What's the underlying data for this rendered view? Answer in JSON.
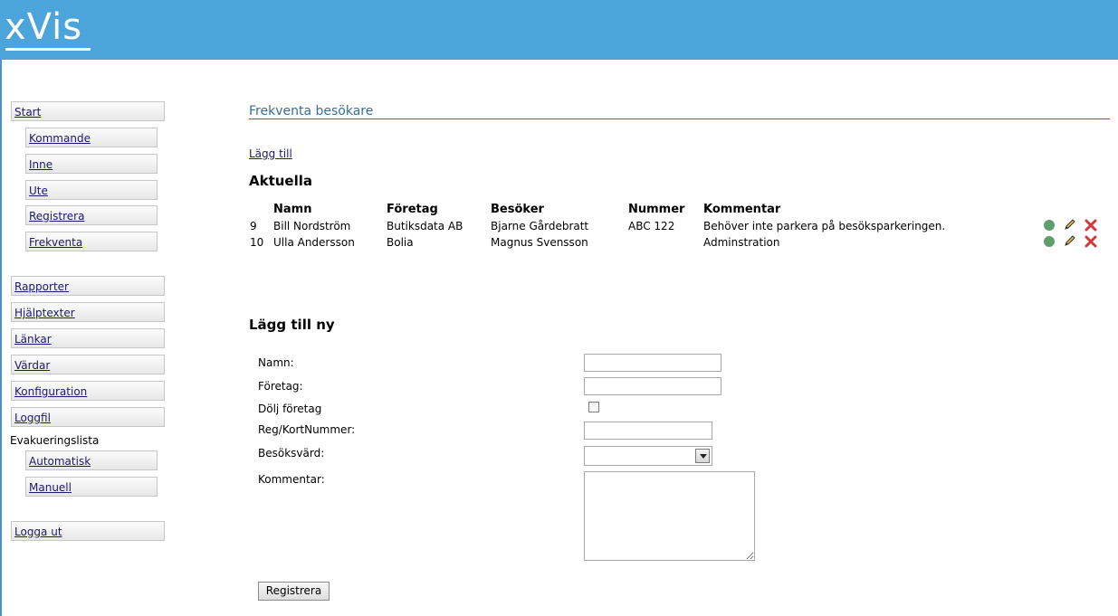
{
  "app": {
    "logo": "xVis"
  },
  "nav": {
    "start": "Start",
    "kommande": "Kommande",
    "inne": "Inne",
    "ute": "Ute",
    "registrera": "Registrera",
    "frekventa": "Frekventa",
    "rapporter": "Rapporter",
    "hjalptexter": "Hjälptexter",
    "lankar": "Länkar",
    "vardar": "Värdar",
    "konfiguration": "Konfiguration",
    "loggfil": "Loggfil",
    "evakueringslista": "Evakueringslista",
    "automatisk": "Automatisk",
    "manuell": "Manuell",
    "logga_ut": "Logga ut"
  },
  "main": {
    "title": "Frekventa besökare",
    "add_link": "Lägg till",
    "current_heading": "Aktuella",
    "columns": [
      "Namn",
      "Företag",
      "Besöker",
      "Nummer",
      "Kommentar"
    ],
    "rows": [
      {
        "id": "9",
        "namn": "Bill Nordström",
        "foretag": "Butiksdata AB",
        "besoker": "Bjarne Gårdebratt",
        "nummer": "ABC 122",
        "kommentar": "Behöver inte parkera på besöksparkeringen."
      },
      {
        "id": "10",
        "namn": "Ulla Andersson",
        "foretag": "Bolia",
        "besoker": "Magnus Svensson",
        "nummer": "",
        "kommentar": "Adminstration"
      }
    ],
    "row_icons": [
      "status-dot-icon",
      "pencil-icon",
      "delete-x-icon"
    ],
    "status_color": "#5f9e6b",
    "delete_color": "#d23a3a"
  },
  "form": {
    "heading": "Lägg till ny",
    "namn_label": "Namn:",
    "foretag_label": "Företag:",
    "dolj_label": "Dölj företag",
    "regnr_label": "Reg/KortNummer:",
    "besoksvard_label": "Besöksvärd:",
    "kommentar_label": "Kommentar:",
    "submit": "Registrera"
  },
  "colors": {
    "header": "#4ca5da",
    "title": "#3b6d97"
  }
}
